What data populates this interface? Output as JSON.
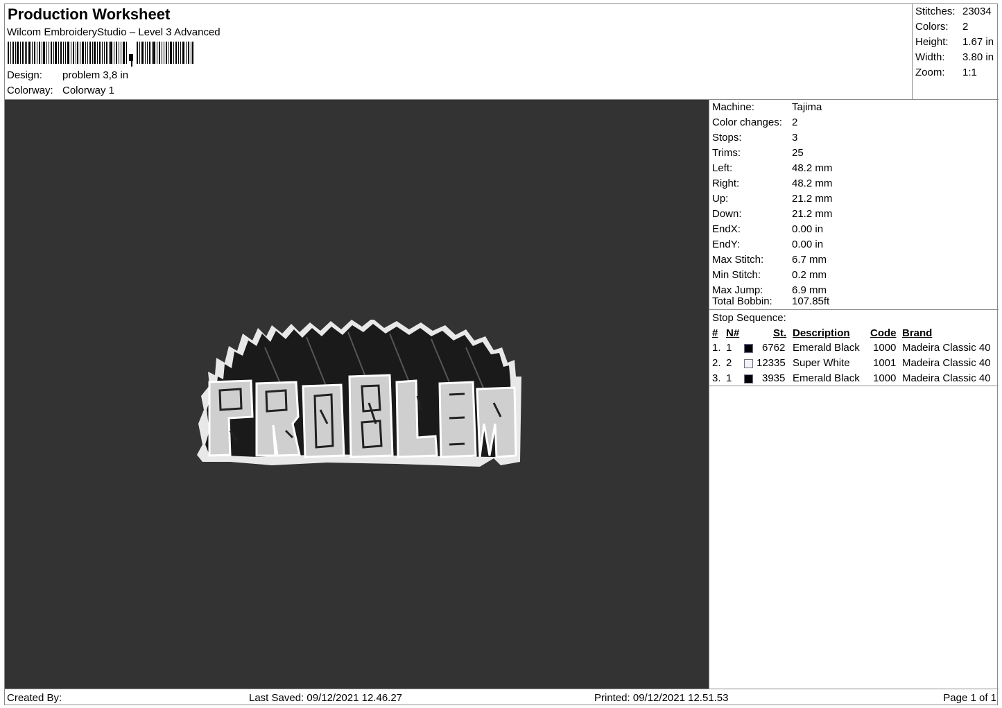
{
  "header": {
    "title": "Production Worksheet",
    "subtitle": "Wilcom EmbroideryStudio – Level 3 Advanced",
    "design_label": "Design:",
    "design_value": "problem 3,8 in",
    "colorway_label": "Colorway:",
    "colorway_value": "Colorway 1"
  },
  "summary": {
    "stitches_label": "Stitches:",
    "stitches_value": "23034",
    "colors_label": "Colors:",
    "colors_value": "2",
    "height_label": "Height:",
    "height_value": "1.67 in",
    "width_label": "Width:",
    "width_value": "3.80 in",
    "zoom_label": "Zoom:",
    "zoom_value": "1:1"
  },
  "props": {
    "machine_label": "Machine:",
    "machine_value": "Tajima",
    "color_changes_label": "Color changes:",
    "color_changes_value": "2",
    "stops_label": "Stops:",
    "stops_value": "3",
    "trims_label": "Trims:",
    "trims_value": "25",
    "left_label": "Left:",
    "left_value": "48.2 mm",
    "right_label": "Right:",
    "right_value": "48.2 mm",
    "up_label": "Up:",
    "up_value": "21.2 mm",
    "down_label": "Down:",
    "down_value": "21.2 mm",
    "endx_label": "EndX:",
    "endx_value": "0.00 in",
    "endy_label": "EndY:",
    "endy_value": "0.00 in",
    "max_stitch_label": "Max Stitch:",
    "max_stitch_value": "6.7 mm",
    "min_stitch_label": "Min Stitch:",
    "min_stitch_value": "0.2 mm",
    "max_jump_label": "Max Jump:",
    "max_jump_value": "6.9 mm",
    "total_bobbin_label": "Total Bobbin:",
    "total_bobbin_value": "107.85ft"
  },
  "stops": {
    "heading": "Stop Sequence:",
    "columns": {
      "num": "#",
      "n": "N#",
      "st": "St.",
      "description": "Description",
      "code": "Code",
      "brand": "Brand"
    },
    "rows": [
      {
        "num": "1.",
        "n": "1",
        "color": "#000000",
        "st": "6762",
        "description": "Emerald Black",
        "code": "1000",
        "brand": "Madeira Classic 40"
      },
      {
        "num": "2.",
        "n": "2",
        "color": "#f2f2f8",
        "st": "12335",
        "description": "Super White",
        "code": "1001",
        "brand": "Madeira Classic 40"
      },
      {
        "num": "3.",
        "n": "1",
        "color": "#000000",
        "st": "3935",
        "description": "Emerald Black",
        "code": "1000",
        "brand": "Madeira Classic 40"
      }
    ]
  },
  "design": {
    "text": "PR08L3M",
    "background": "#333333"
  },
  "footer": {
    "created_by": "Created By:",
    "last_saved": "Last Saved: 09/12/2021 12.46.27",
    "printed": "Printed: 09/12/2021 12.51.53",
    "page": "Page 1 of 1"
  }
}
